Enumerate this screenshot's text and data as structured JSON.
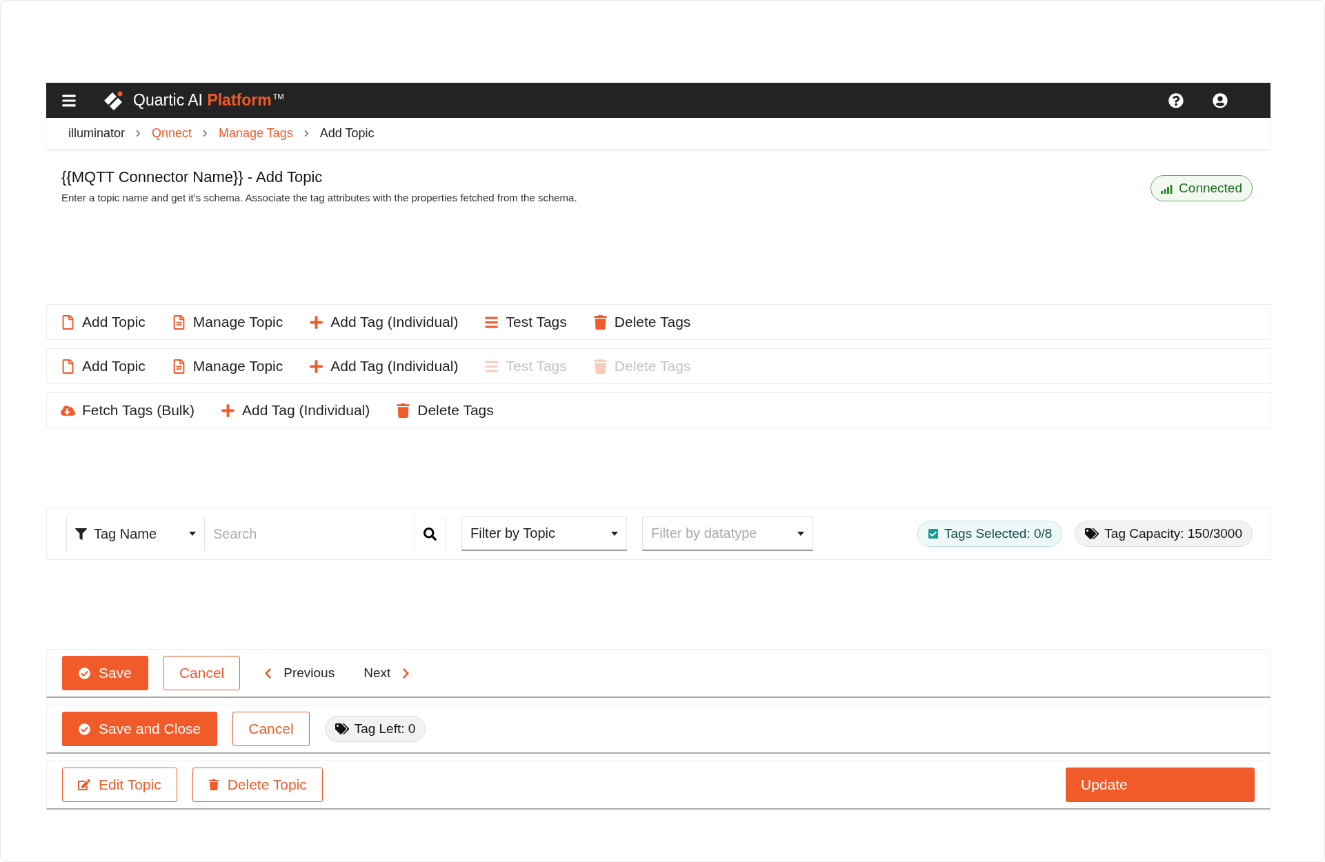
{
  "header": {
    "brand": "Quartic AI",
    "brand_accent": "Platform",
    "trademark": "TM"
  },
  "breadcrumb": [
    {
      "label": "illuminator",
      "kind": "plain"
    },
    {
      "label": "Qnnect",
      "kind": "link"
    },
    {
      "label": "Manage Tags",
      "kind": "link"
    },
    {
      "label": "Add Topic",
      "kind": "plain"
    }
  ],
  "page": {
    "title": "{{MQTT Connector Name}} - Add Topic",
    "description": "Enter a topic name and get it’s schema. Associate the tag attributes with the properties fetched from the schema.",
    "status": "Connected"
  },
  "toolbars": [
    [
      {
        "label": "Add Topic",
        "kind": "add-topic",
        "disabled": false
      },
      {
        "label": "Manage Topic",
        "kind": "manage-topic",
        "disabled": false
      },
      {
        "label": "Add Tag (Individual)",
        "kind": "add-tag",
        "disabled": false
      },
      {
        "label": "Test Tags",
        "kind": "test-tags",
        "disabled": false
      },
      {
        "label": "Delete Tags",
        "kind": "delete-tags",
        "disabled": false
      }
    ],
    [
      {
        "label": "Add Topic",
        "kind": "add-topic",
        "disabled": false
      },
      {
        "label": "Manage Topic",
        "kind": "manage-topic",
        "disabled": false
      },
      {
        "label": "Add Tag (Individual)",
        "kind": "add-tag",
        "disabled": false
      },
      {
        "label": "Test Tags",
        "kind": "test-tags",
        "disabled": true
      },
      {
        "label": "Delete Tags",
        "kind": "delete-tags",
        "disabled": true
      }
    ],
    [
      {
        "label": "Fetch Tags (Bulk)",
        "kind": "fetch-tags",
        "disabled": false
      },
      {
        "label": "Add Tag (Individual)",
        "kind": "add-tag",
        "disabled": false
      },
      {
        "label": "Delete Tags",
        "kind": "delete-tags",
        "disabled": false
      }
    ]
  ],
  "filters": {
    "field": "Tag Name",
    "search_placeholder": "Search",
    "topic": "Filter by Topic",
    "datatype_placeholder": "Filter by datatype",
    "tags_selected": {
      "label": "Tags Selected: 0/8",
      "checked": true
    },
    "capacity": "Tag Capacity: 150/3000"
  },
  "action_rows": [
    [
      {
        "kind": "save",
        "label": "Save"
      },
      {
        "kind": "cancel",
        "label": "Cancel"
      },
      {
        "kind": "prev",
        "label": "Previous"
      },
      {
        "kind": "next",
        "label": "Next"
      }
    ],
    [
      {
        "kind": "save",
        "label": "Save and Close"
      },
      {
        "kind": "cancel",
        "label": "Cancel"
      },
      {
        "kind": "chip",
        "label": "Tag Left: 0"
      }
    ],
    [
      {
        "kind": "edit",
        "label": "Edit Topic"
      },
      {
        "kind": "delete",
        "label": "Delete Topic"
      },
      {
        "kind": "update",
        "label": "Update"
      }
    ]
  ]
}
